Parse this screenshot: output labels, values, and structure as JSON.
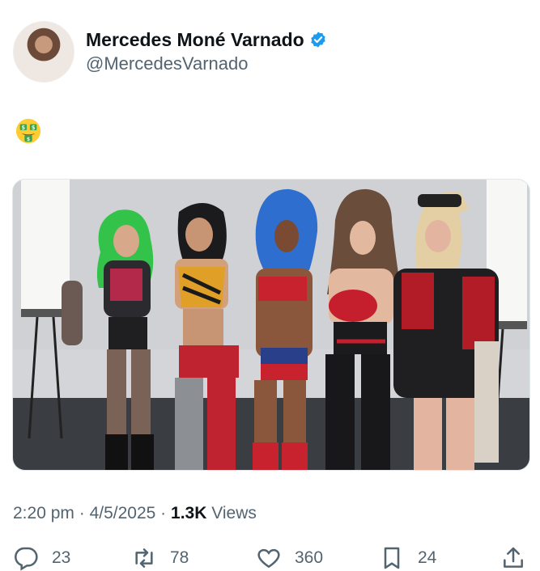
{
  "author": {
    "display_name": "Mercedes Moné Varnado",
    "handle": "@MercedesVarnado",
    "verified": true,
    "avatar_icon": "profile-avatar"
  },
  "tweet": {
    "emoji_icon": "money-mouth-face",
    "media_icon": "photo-five-wrestlers"
  },
  "meta": {
    "time": "2:20 pm",
    "sep1": "·",
    "date": "4/5/2025",
    "sep2": "·",
    "views_count": "1.3K",
    "views_label": "Views"
  },
  "actions": {
    "reply_count": "23",
    "repost_count": "78",
    "like_count": "360",
    "bookmark_count": "24"
  },
  "colors": {
    "verified": "#1d9bf0",
    "secondary_text": "#536471",
    "primary_text": "#0f1419"
  }
}
